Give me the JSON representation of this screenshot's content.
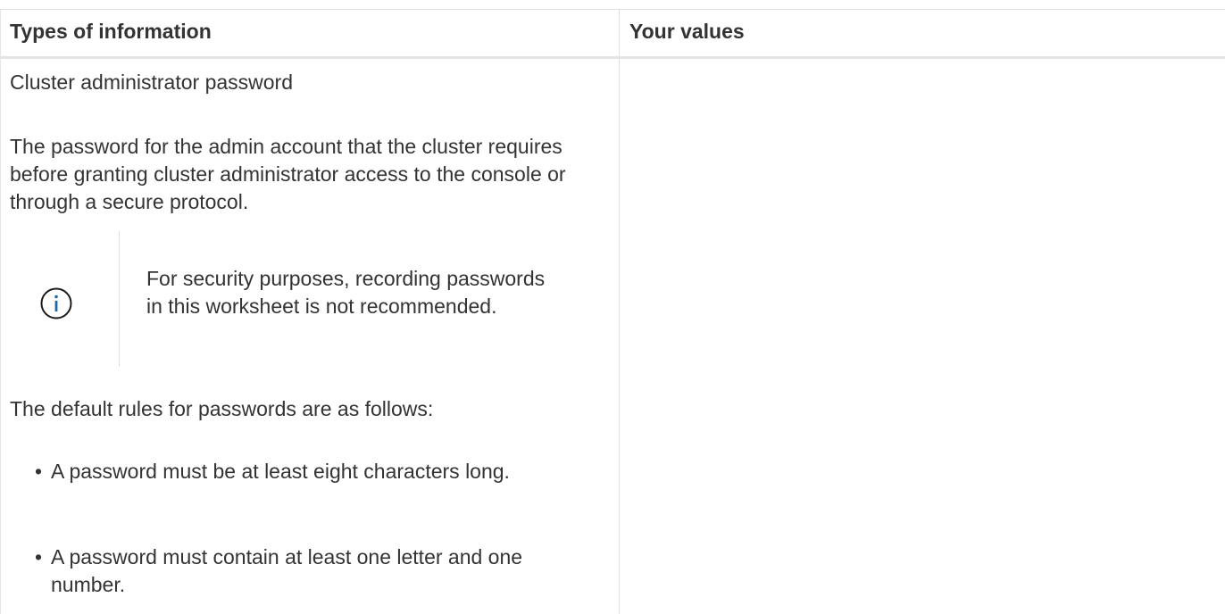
{
  "table": {
    "headers": {
      "types": "Types of information",
      "values": "Your values"
    },
    "row": {
      "title": "Cluster administrator password",
      "description": "The password for the admin account that the cluster requires before granting cluster administrator access to the console or through a secure protocol.",
      "note": {
        "icon": "info-icon",
        "text": "For security purposes, recording passwords in this worksheet is not recommended."
      },
      "rules_intro": "The default rules for passwords are as follows:",
      "rules": [
        "A password must be at least eight characters long.",
        "A password must contain at least one letter and one number."
      ],
      "value": ""
    }
  },
  "colors": {
    "text": "#333333",
    "border": "#e0e0e0",
    "info_icon": "#1a6aa8"
  }
}
